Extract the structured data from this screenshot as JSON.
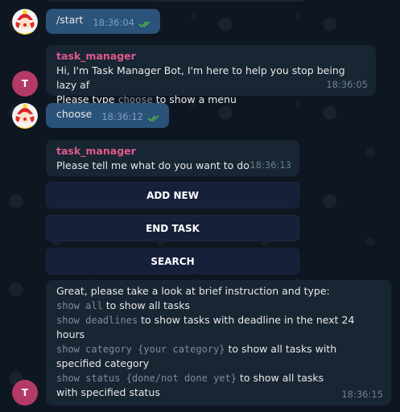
{
  "messages": [
    {
      "text": "/start",
      "time": "18:36:04"
    },
    {
      "sender": "task_manager",
      "line1": "Hi, I'm Task Manager Bot, I'm here to help you stop being lazy af",
      "line2_pre": "Please type ",
      "line2_code": "choose",
      "line2_post": " to show a menu",
      "time": "18:36:05",
      "avatar_letter": "T"
    },
    {
      "text": "choose",
      "time": "18:36:12"
    },
    {
      "sender": "task_manager",
      "text": "Please tell me what do you want to do",
      "time": "18:36:13"
    },
    {
      "intro": "Great, please take a look at brief instruction and type:",
      "items": [
        {
          "code": "show all",
          "text": " to show all tasks"
        },
        {
          "code": "show deadlines",
          "text": " to show tasks with deadline in the next 24 hours"
        },
        {
          "code": "show category {your category}",
          "text": " to show all tasks with specified category"
        },
        {
          "code": "show status {done/not done yet}",
          "text": " to show all tasks with specified status"
        }
      ],
      "time": "18:36:15",
      "avatar_letter": "T"
    }
  ],
  "keyboard": [
    "ADD NEW",
    "END TASK",
    "SEARCH"
  ],
  "colors": {
    "background": "#0e1621",
    "bubble": "#182533",
    "sender": "#e05a8d",
    "check": "#4fae4e"
  },
  "icons": [
    "user-avatar-clown",
    "double-check-icon"
  ]
}
